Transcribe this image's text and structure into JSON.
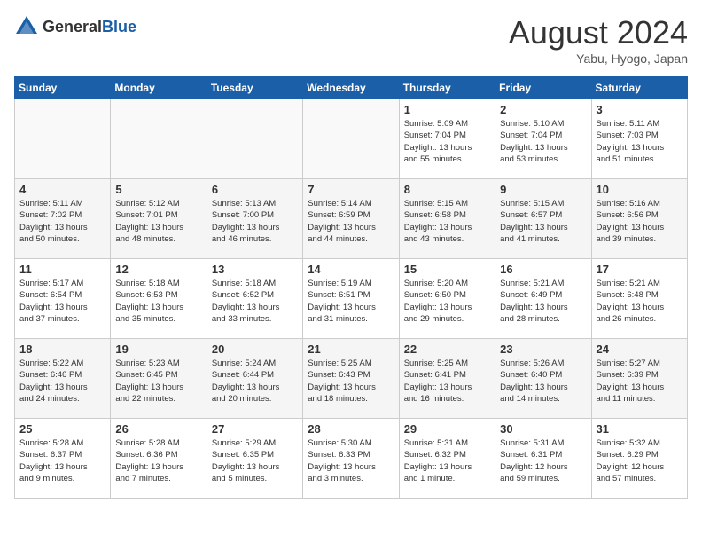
{
  "header": {
    "logo_general": "General",
    "logo_blue": "Blue",
    "month_year": "August 2024",
    "location": "Yabu, Hyogo, Japan"
  },
  "weekdays": [
    "Sunday",
    "Monday",
    "Tuesday",
    "Wednesday",
    "Thursday",
    "Friday",
    "Saturday"
  ],
  "weeks": [
    [
      {
        "day": "",
        "info": ""
      },
      {
        "day": "",
        "info": ""
      },
      {
        "day": "",
        "info": ""
      },
      {
        "day": "",
        "info": ""
      },
      {
        "day": "1",
        "info": "Sunrise: 5:09 AM\nSunset: 7:04 PM\nDaylight: 13 hours\nand 55 minutes."
      },
      {
        "day": "2",
        "info": "Sunrise: 5:10 AM\nSunset: 7:04 PM\nDaylight: 13 hours\nand 53 minutes."
      },
      {
        "day": "3",
        "info": "Sunrise: 5:11 AM\nSunset: 7:03 PM\nDaylight: 13 hours\nand 51 minutes."
      }
    ],
    [
      {
        "day": "4",
        "info": "Sunrise: 5:11 AM\nSunset: 7:02 PM\nDaylight: 13 hours\nand 50 minutes."
      },
      {
        "day": "5",
        "info": "Sunrise: 5:12 AM\nSunset: 7:01 PM\nDaylight: 13 hours\nand 48 minutes."
      },
      {
        "day": "6",
        "info": "Sunrise: 5:13 AM\nSunset: 7:00 PM\nDaylight: 13 hours\nand 46 minutes."
      },
      {
        "day": "7",
        "info": "Sunrise: 5:14 AM\nSunset: 6:59 PM\nDaylight: 13 hours\nand 44 minutes."
      },
      {
        "day": "8",
        "info": "Sunrise: 5:15 AM\nSunset: 6:58 PM\nDaylight: 13 hours\nand 43 minutes."
      },
      {
        "day": "9",
        "info": "Sunrise: 5:15 AM\nSunset: 6:57 PM\nDaylight: 13 hours\nand 41 minutes."
      },
      {
        "day": "10",
        "info": "Sunrise: 5:16 AM\nSunset: 6:56 PM\nDaylight: 13 hours\nand 39 minutes."
      }
    ],
    [
      {
        "day": "11",
        "info": "Sunrise: 5:17 AM\nSunset: 6:54 PM\nDaylight: 13 hours\nand 37 minutes."
      },
      {
        "day": "12",
        "info": "Sunrise: 5:18 AM\nSunset: 6:53 PM\nDaylight: 13 hours\nand 35 minutes."
      },
      {
        "day": "13",
        "info": "Sunrise: 5:18 AM\nSunset: 6:52 PM\nDaylight: 13 hours\nand 33 minutes."
      },
      {
        "day": "14",
        "info": "Sunrise: 5:19 AM\nSunset: 6:51 PM\nDaylight: 13 hours\nand 31 minutes."
      },
      {
        "day": "15",
        "info": "Sunrise: 5:20 AM\nSunset: 6:50 PM\nDaylight: 13 hours\nand 29 minutes."
      },
      {
        "day": "16",
        "info": "Sunrise: 5:21 AM\nSunset: 6:49 PM\nDaylight: 13 hours\nand 28 minutes."
      },
      {
        "day": "17",
        "info": "Sunrise: 5:21 AM\nSunset: 6:48 PM\nDaylight: 13 hours\nand 26 minutes."
      }
    ],
    [
      {
        "day": "18",
        "info": "Sunrise: 5:22 AM\nSunset: 6:46 PM\nDaylight: 13 hours\nand 24 minutes."
      },
      {
        "day": "19",
        "info": "Sunrise: 5:23 AM\nSunset: 6:45 PM\nDaylight: 13 hours\nand 22 minutes."
      },
      {
        "day": "20",
        "info": "Sunrise: 5:24 AM\nSunset: 6:44 PM\nDaylight: 13 hours\nand 20 minutes."
      },
      {
        "day": "21",
        "info": "Sunrise: 5:25 AM\nSunset: 6:43 PM\nDaylight: 13 hours\nand 18 minutes."
      },
      {
        "day": "22",
        "info": "Sunrise: 5:25 AM\nSunset: 6:41 PM\nDaylight: 13 hours\nand 16 minutes."
      },
      {
        "day": "23",
        "info": "Sunrise: 5:26 AM\nSunset: 6:40 PM\nDaylight: 13 hours\nand 14 minutes."
      },
      {
        "day": "24",
        "info": "Sunrise: 5:27 AM\nSunset: 6:39 PM\nDaylight: 13 hours\nand 11 minutes."
      }
    ],
    [
      {
        "day": "25",
        "info": "Sunrise: 5:28 AM\nSunset: 6:37 PM\nDaylight: 13 hours\nand 9 minutes."
      },
      {
        "day": "26",
        "info": "Sunrise: 5:28 AM\nSunset: 6:36 PM\nDaylight: 13 hours\nand 7 minutes."
      },
      {
        "day": "27",
        "info": "Sunrise: 5:29 AM\nSunset: 6:35 PM\nDaylight: 13 hours\nand 5 minutes."
      },
      {
        "day": "28",
        "info": "Sunrise: 5:30 AM\nSunset: 6:33 PM\nDaylight: 13 hours\nand 3 minutes."
      },
      {
        "day": "29",
        "info": "Sunrise: 5:31 AM\nSunset: 6:32 PM\nDaylight: 13 hours\nand 1 minute."
      },
      {
        "day": "30",
        "info": "Sunrise: 5:31 AM\nSunset: 6:31 PM\nDaylight: 12 hours\nand 59 minutes."
      },
      {
        "day": "31",
        "info": "Sunrise: 5:32 AM\nSunset: 6:29 PM\nDaylight: 12 hours\nand 57 minutes."
      }
    ]
  ]
}
